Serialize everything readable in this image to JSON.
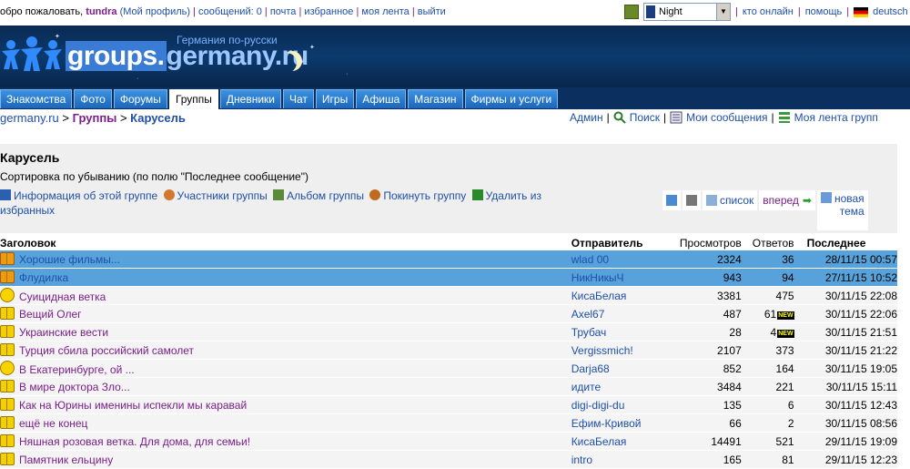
{
  "topbar": {
    "greeting": "обро пожаловать,",
    "username": "tundra",
    "links": [
      "(Мой профиль)",
      "сообщений: 0",
      "почта",
      "избранное",
      "моя лента",
      "выйти"
    ],
    "skin_value": "Night",
    "right_links": [
      "кто онлайн",
      "помощь"
    ],
    "language": "deutsch"
  },
  "header": {
    "logo_part1": "groups.",
    "logo_part2": "germany.ru",
    "subtitle": "Германия по-русски"
  },
  "nav": {
    "tabs": [
      "Знакомства",
      "Фото",
      "Форумы",
      "Группы",
      "Дневники",
      "Чат",
      "Игры",
      "Афиша",
      "Магазин",
      "Фирмы и услуги"
    ],
    "active": "Группы"
  },
  "breadcrumb": {
    "root": "germany.ru",
    "sep": ">",
    "groups": "Группы",
    "current": "Карусель"
  },
  "toplinks": {
    "admin": "Админ",
    "search": "Поиск",
    "my_messages": "Мои сообщения",
    "group_feed": "Моя лента групп"
  },
  "panel": {
    "title": "Карусель",
    "sort": "Сортировка по убыванию (по полю \"Последнее сообщение\")",
    "actions": {
      "info": "Информация об этой группе",
      "members": "Участники группы",
      "album": "Альбом группы",
      "leave": "Покинуть группу",
      "unfav": "Удалить из избранных"
    },
    "tools": {
      "list": "список",
      "forward": "вперед",
      "new_topic_1": "новая",
      "new_topic_2": "тема"
    }
  },
  "table": {
    "headers": {
      "title": "Заголовок",
      "sender": "Отправитель",
      "views": "Просмотров",
      "replies": "Ответов",
      "last": "Последнее"
    },
    "rows": [
      {
        "icon": "book-orange-icon",
        "title": "Хорошие фильмы...",
        "sender": "wlad 00",
        "views": "2324",
        "replies": "36",
        "new": false,
        "last": "28/11/15 00:57",
        "highlight": true
      },
      {
        "icon": "book-orange-icon",
        "title": "Флудилка",
        "sender": "НикНикыЧ",
        "views": "943",
        "replies": "94",
        "new": false,
        "last": "27/11/15 10:52",
        "highlight": true
      },
      {
        "icon": "smiley-icon",
        "title": "Суицидная ветка",
        "sender": "КисаБелая",
        "views": "3381",
        "replies": "475",
        "new": false,
        "last": "30/11/15 22:08",
        "highlight": false
      },
      {
        "icon": "book-icon",
        "title": "Вещий Олег",
        "sender": "Axel67",
        "views": "487",
        "replies": "61",
        "new": true,
        "last": "30/11/15 22:06",
        "highlight": false
      },
      {
        "icon": "book-icon",
        "title": "Украинские вести",
        "sender": "Трубач",
        "views": "28",
        "replies": "4",
        "new": true,
        "last": "30/11/15 21:51",
        "highlight": false
      },
      {
        "icon": "book-icon",
        "title": "Турция сбила российский самолет",
        "sender": "Vergissmich!",
        "views": "2107",
        "replies": "373",
        "new": false,
        "last": "30/11/15 21:22",
        "highlight": false
      },
      {
        "icon": "smiley-icon",
        "title": "В Екатеринбурге, ой ...",
        "sender": "Darja68",
        "views": "852",
        "replies": "164",
        "new": false,
        "last": "30/11/15 19:05",
        "highlight": false
      },
      {
        "icon": "book-icon",
        "title": "В мире доктора Зло...",
        "sender": "идите",
        "views": "3484",
        "replies": "221",
        "new": false,
        "last": "30/11/15 15:11",
        "highlight": false
      },
      {
        "icon": "book-icon",
        "title": "Как на Юрины именины испекли мы каравай",
        "sender": "digi-digi-du",
        "views": "135",
        "replies": "6",
        "new": false,
        "last": "30/11/15 12:43",
        "highlight": false
      },
      {
        "icon": "book-icon",
        "title": "ещё не конец",
        "sender": "Ефим-Кривой",
        "views": "66",
        "replies": "2",
        "new": false,
        "last": "30/11/15 08:56",
        "highlight": false
      },
      {
        "icon": "book-icon",
        "title": "Няшная розовая ветка. Для дома, для семьи!",
        "sender": "КисаБелая",
        "views": "14491",
        "replies": "521",
        "new": false,
        "last": "29/11/15 19:09",
        "highlight": false
      },
      {
        "icon": "book-icon",
        "title": "Памятник ельцину",
        "sender": "intro",
        "views": "165",
        "replies": "81",
        "new": false,
        "last": "29/11/15 12:23",
        "highlight": false
      }
    ],
    "new_label": "NEW"
  }
}
